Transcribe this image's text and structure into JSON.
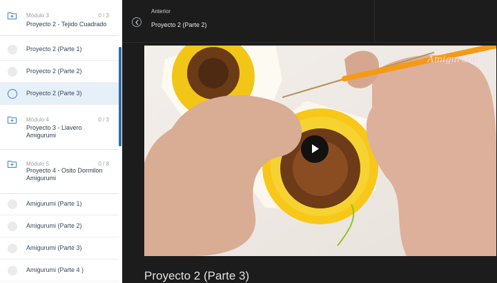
{
  "sidebar": {
    "modules": [
      {
        "number": "Módulo 3",
        "title": "Proyecto 2 - Tejido Cuadrado",
        "count": "0 / 3"
      },
      {
        "number": "Módulo 4",
        "title": "Proyecto 3 - Llavero Amigurumi",
        "count": "0 / 3"
      },
      {
        "number": "Módulo 5",
        "title": "Proyecto 4 - Osito Dormilon Amigurumi",
        "count": "0 / 8"
      }
    ],
    "lessons_m3": [
      {
        "label": "Proyecto 2 (Parte 1)"
      },
      {
        "label": "Proyecto 2 (Parte 2)"
      },
      {
        "label": "Proyecto 2 (Parte 3)"
      }
    ],
    "lessons_m5": [
      {
        "label": "Amigurumi (Parte 1)"
      },
      {
        "label": "Amigurumi (Parte 2)"
      },
      {
        "label": "Amigurumi (Parte 3)"
      },
      {
        "label": "Amigurumi (Parte 4 )"
      }
    ]
  },
  "header": {
    "prev_label": "Anterior",
    "prev_title": "Proyecto 2 (Parte 2)"
  },
  "video": {
    "watermark": "Amigurumi"
  },
  "lesson": {
    "title": "Proyecto 2 (Parte 3)"
  },
  "colors": {
    "accent": "#3d82c4",
    "active_bg": "#e6f0f9",
    "dark_bg": "#1c1c1c"
  }
}
